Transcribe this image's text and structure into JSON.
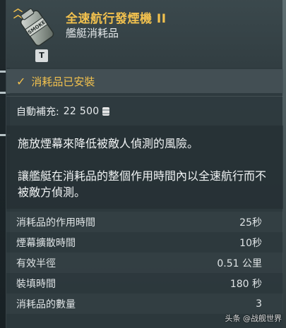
{
  "item": {
    "title": "全速航行發煙機 II",
    "subtitle": "艦艇消耗品",
    "icon": "smoke-generator-icon",
    "icon_label": "SMOKE",
    "hotkey": "T"
  },
  "status": {
    "installed_label": "消耗品已安裝"
  },
  "resupply": {
    "label": "自動補充:",
    "value": "22 500",
    "currency_icon": "silver-credits-icon"
  },
  "description": {
    "line1": "施放煙幕來降低被敵人偵測的風險。",
    "line2": "讓艦艇在消耗品的整個作用時間內以全速航行而不被敵方偵測。"
  },
  "stats": [
    {
      "label": "消耗品的作用時間",
      "value": "25秒"
    },
    {
      "label": "煙幕擴散時間",
      "value": "10秒"
    },
    {
      "label": "有效半徑",
      "value": "0.51 公里"
    },
    {
      "label": "裝填時間",
      "value": "180 秒"
    },
    {
      "label": "消耗品的數量",
      "value": "3"
    }
  ],
  "watermark": "头条 @战舰世界",
  "colors": {
    "accent": "#f2c14e",
    "panel": "#2c383c",
    "text": "#e8ecee"
  }
}
